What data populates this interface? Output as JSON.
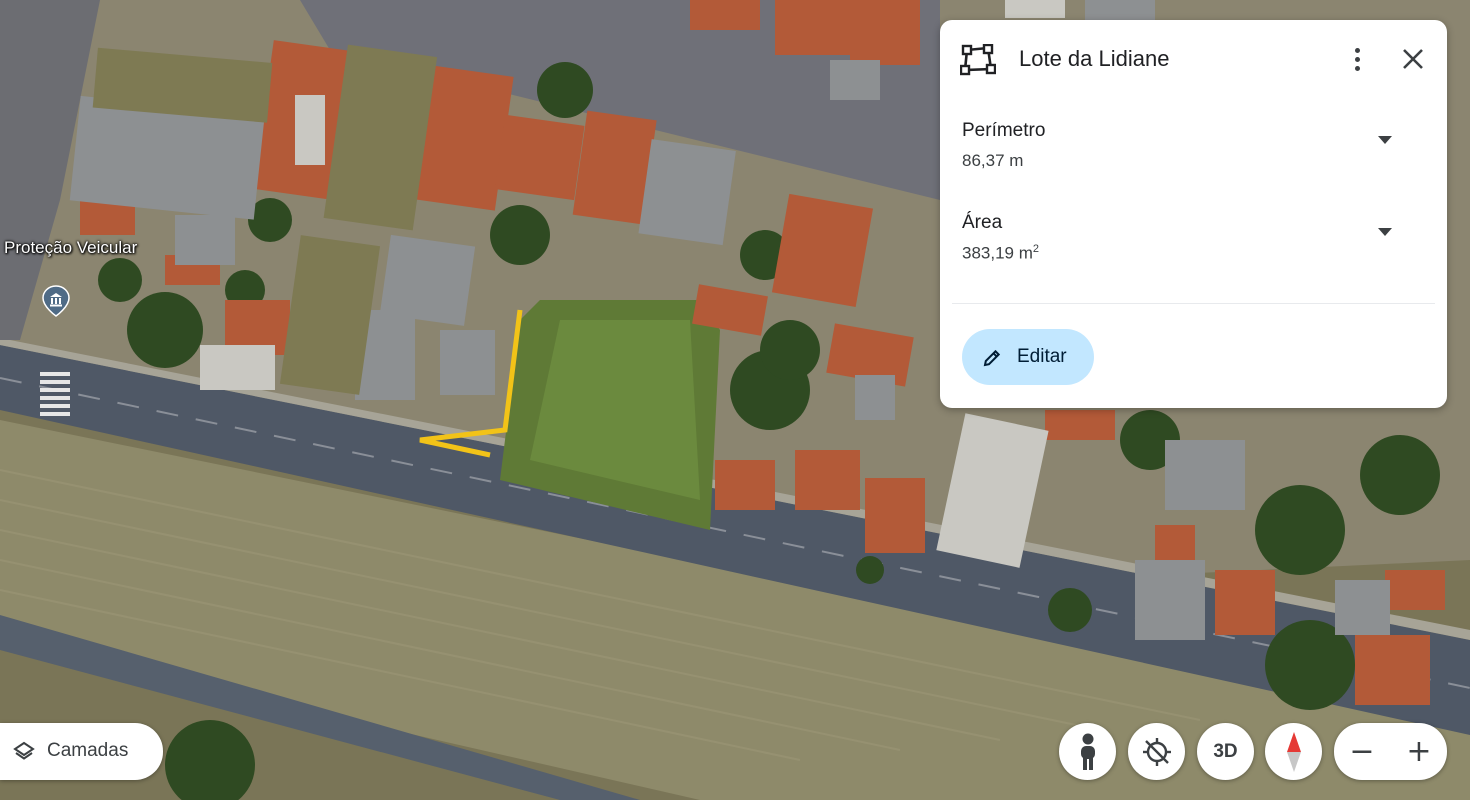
{
  "map": {
    "poi_label": "Proteção Veicular",
    "poi_icon": "museum-pin-icon"
  },
  "panel": {
    "title": "Lote da Lidiane",
    "shape_icon": "polygon-shape-icon",
    "more_icon": "more-vertical-icon",
    "close_icon": "close-icon",
    "metrics": [
      {
        "label": "Perímetro",
        "value": "86,37 m"
      },
      {
        "label": "Área",
        "value": "383,19 m",
        "unit_sup": "2"
      }
    ],
    "edit_label": "Editar"
  },
  "controls": {
    "layers_label": "Camadas",
    "pegman_icon": "pegman-icon",
    "location_icon": "location-off-icon",
    "view_3d_label": "3D",
    "compass_icon": "compass-icon",
    "zoom_out": "−",
    "zoom_in": "+"
  },
  "colors": {
    "edit_button_bg": "#c2e7ff",
    "compass_north": "#e53935",
    "parcel_outline": "#f2c318"
  }
}
